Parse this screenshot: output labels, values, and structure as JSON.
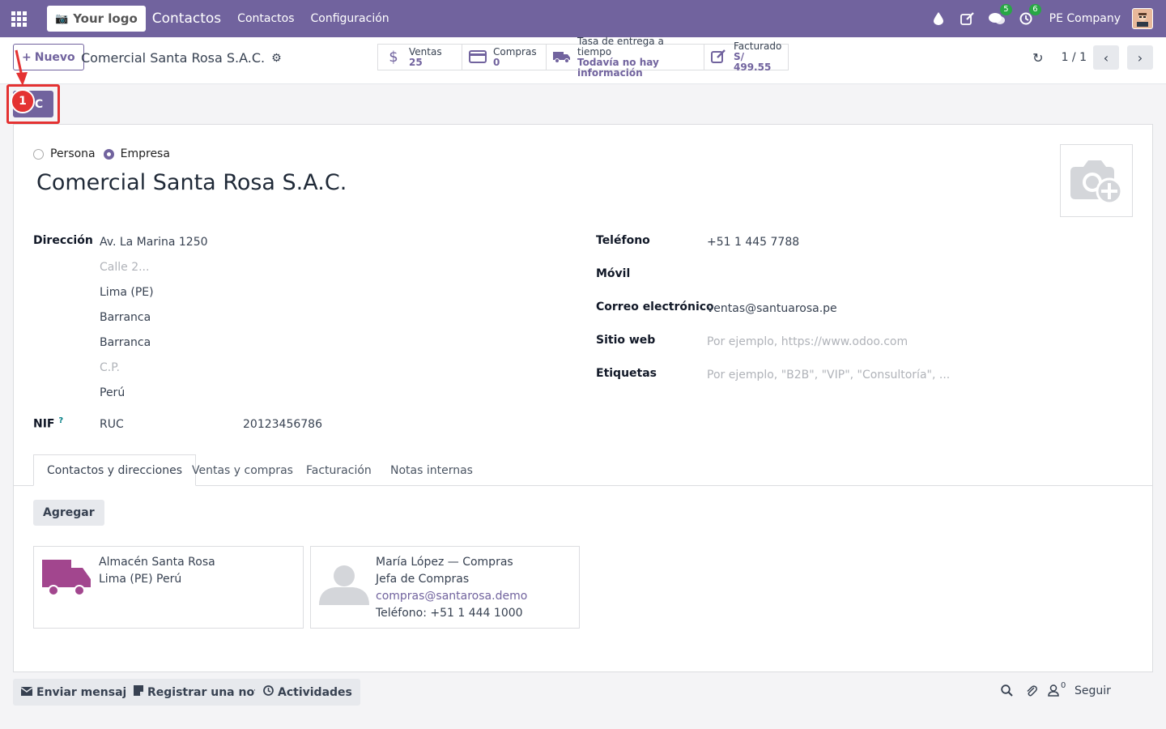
{
  "navbar": {
    "logo_text": "Your logo",
    "app_name": "Contactos",
    "menus": [
      "Contactos",
      "Configuración"
    ],
    "messages_badge": "5",
    "activities_badge": "6",
    "company": "PE Company"
  },
  "control": {
    "new_label": "Nuevo",
    "breadcrumb": "Comercial Santa Rosa S.A.C.",
    "stats": [
      {
        "label": "Ventas",
        "value": "25",
        "icon": "dollar-icon"
      },
      {
        "label": "Compras",
        "value": "0",
        "icon": "credit-card-icon"
      },
      {
        "label": "Tasa de entrega a tiempo",
        "value": "Todavía no hay información",
        "icon": "truck-icon"
      },
      {
        "label": "Facturado",
        "value": "S/ 499.55",
        "icon": "edit-invoice-icon"
      }
    ],
    "pager": "1 / 1"
  },
  "status_button": {
    "label": "C",
    "annotation_number": "1"
  },
  "form": {
    "company_type": {
      "person": "Persona",
      "company": "Empresa",
      "selected": "Empresa"
    },
    "name": "Comercial Santa Rosa S.A.C.",
    "address_label": "Dirección",
    "street": "Av. La Marina 1250",
    "street2_placeholder": "Calle 2...",
    "city": "Lima (PE)",
    "line3": "Barranca",
    "line4": "Barranca",
    "zip_placeholder": "C.P.",
    "country": "Perú",
    "vat_label": "NIF",
    "vat_help": "?",
    "id_type": "RUC",
    "vat_value": "20123456786",
    "phone_label": "Teléfono",
    "phone": "+51 1 445 7788",
    "mobile_label": "Móvil",
    "email_label": "Correo electrónico",
    "email": "ventas@santuarosa.pe",
    "website_label": "Sitio web",
    "website_placeholder": "Por ejemplo, https://www.odoo.com",
    "tags_label": "Etiquetas",
    "tags_placeholder": "Por ejemplo, \"B2B\", \"VIP\", \"Consultoría\", ..."
  },
  "tabs": [
    "Contactos y direcciones",
    "Ventas y compras",
    "Facturación",
    "Notas internas"
  ],
  "contacts": {
    "add_label": "Agregar",
    "cards": [
      {
        "lines": [
          "Almacén Santa Rosa",
          "Lima (PE) Perú"
        ]
      },
      {
        "lines": [
          "María López — Compras",
          "Jefa de Compras",
          "compras@santarosa.demo",
          "Teléfono: +51 1 444 1000"
        ]
      }
    ]
  },
  "chatter": {
    "send_message": "Enviar mensaje",
    "log_note": "Registrar una nota",
    "activities": "Actividades",
    "followers_count": "0",
    "follow": "Seguir"
  },
  "colors": {
    "brand": "#71639e",
    "annotation": "#e43232",
    "badge": "#28a745"
  }
}
